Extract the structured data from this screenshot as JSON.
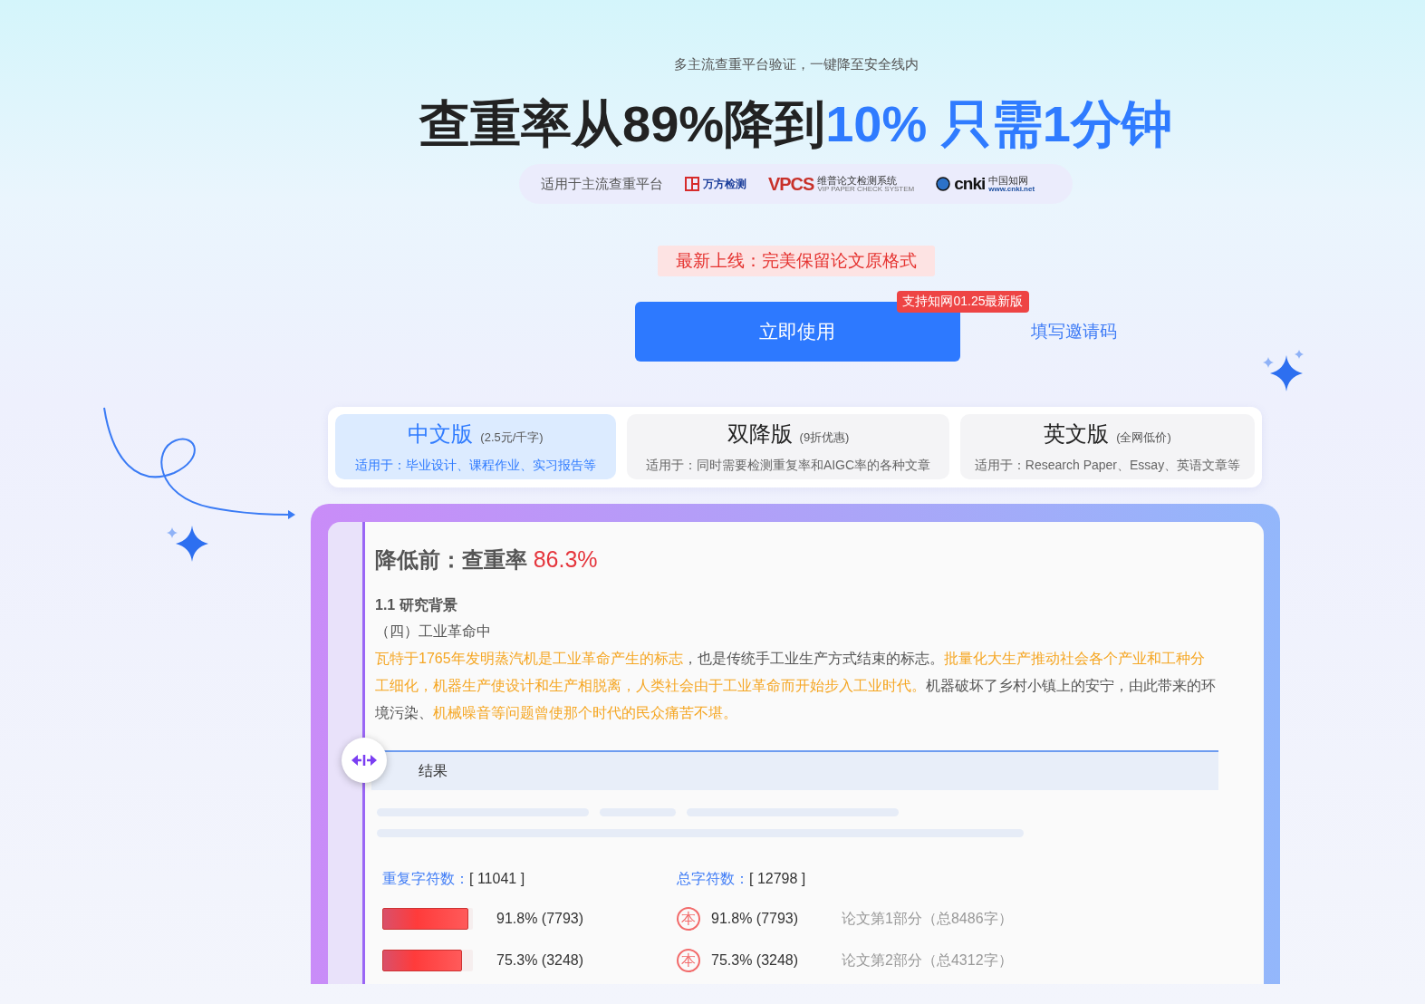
{
  "hero": {
    "subtitle": "多主流查重平台验证，一键降至安全线内",
    "headline": [
      {
        "text": "查重率从89%降到",
        "highlight": false
      },
      {
        "text": "10% 只需1分钟",
        "highlight": true
      }
    ],
    "platforms": {
      "label": "适用于主流查重平台",
      "logos": [
        {
          "kind": "wanfang",
          "name": "万方检测"
        },
        {
          "kind": "vpcs",
          "mark": "VPCS",
          "name": "维普论文检测系统",
          "sub": "VIP PAPER CHECK SYSTEM"
        },
        {
          "kind": "cnki",
          "mark": "cnki",
          "name": "中国知网",
          "sub": "www.cnki.net"
        }
      ]
    },
    "notice": "最新上线：完美保留论文原格式",
    "primary_button": "立即使用",
    "badge": "支持知网01.25最新版",
    "invite_link": "填写邀请码"
  },
  "tabs": [
    {
      "title": "中文版",
      "price": "(2.5元/千字)",
      "desc": "适用于：毕业设计、课程作业、实习报告等",
      "selected": true
    },
    {
      "title": "双降版",
      "price": "(9折优惠)",
      "desc": "适用于：同时需要检测重复率和AIGC率的各种文章",
      "selected": false
    },
    {
      "title": "英文版",
      "price": "(全网低价)",
      "desc": "适用于：Research Paper、Essay、英语文章等",
      "selected": false
    }
  ],
  "document": {
    "label": "降低前：查重率",
    "rate": "86.3%",
    "heading": "1.1 研究背景",
    "subheading": "（四）工业革命中",
    "segments": [
      {
        "text": "瓦特于1765年发明蒸汽机是工业革命产生的标志",
        "highlight": true
      },
      {
        "text": "，也是传统手工业生产方式结束的标志。",
        "highlight": false
      },
      {
        "text": "批量化大生产推动社会各个产业和工种分工细化，机器生产使设计和生产相脱离，人类社会由于工业革命而开始步入工业时代。",
        "highlight": true
      },
      {
        "text": "机器破坏了乡村小镇上的安宁，由此带来的环境污染、",
        "highlight": false
      },
      {
        "text": "机械噪音等问题曾使那个时代的民众痛苦不堪。",
        "highlight": true
      }
    ],
    "result_title": "结果",
    "repeat_label": "重复字符数：",
    "repeat_value": "[ 11041 ]",
    "total_label": "总字符数：",
    "total_value": "[ 12798 ]",
    "rows": [
      {
        "bar_text": "91.8% (7793)",
        "level": 0.95,
        "stamp": "本",
        "value": "91.8% (7793)",
        "part": "论文第1部分（总8486字）"
      },
      {
        "bar_text": "75.3% (3248)",
        "level": 0.88,
        "stamp": "本",
        "value": "75.3% (3248)",
        "part": "论文第2部分（总4312字）"
      }
    ]
  }
}
